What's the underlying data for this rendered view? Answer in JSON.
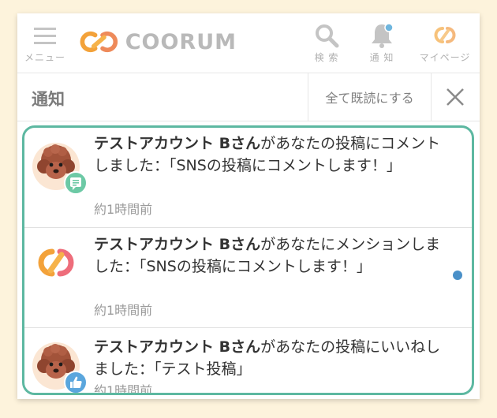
{
  "header": {
    "menu_label": "メニュー",
    "brand": "COORUM",
    "search_label": "検 索",
    "notify_label": "通 知",
    "mypage_label": "マイページ"
  },
  "panel": {
    "title": "通知",
    "mark_all_read": "全て既読にする"
  },
  "notifications": [
    {
      "actor": "テストアカウント Bさん",
      "message": "があなたの投稿にコメントしました：「SNSの投稿にコメントします！」",
      "time": "約1時間前",
      "avatar": "dog-avatar",
      "badge_icon": "comment-icon",
      "unread": false
    },
    {
      "actor": "テストアカウント Bさん",
      "message": "があなたにメンションしました：「SNSの投稿にコメントします！」",
      "time": "約1時間前",
      "avatar": "coorum-logo-avatar",
      "badge_icon": "",
      "unread": true
    },
    {
      "actor": "テストアカウント Bさん",
      "message": "があなたの投稿にいいねしました：「テスト投稿」",
      "time": "約1時間前",
      "avatar": "dog-avatar",
      "badge_icon": "thumbs-up-icon",
      "unread": false
    }
  ],
  "colors": {
    "background": "#fdf3dc",
    "list_border": "#5db8a1",
    "unread_dot": "#4a90c8",
    "comment_badge": "#6cc9a5",
    "like_badge": "#5aa6dd",
    "logo_orange": "#f3a23a",
    "logo_pink": "#ee6d7b"
  }
}
